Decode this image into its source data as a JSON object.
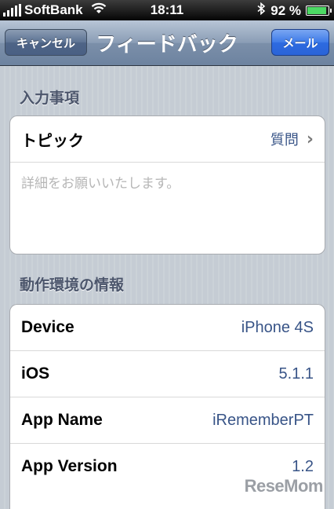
{
  "status_bar": {
    "carrier": "SoftBank",
    "time": "18:11",
    "battery_percent": "92 %",
    "battery_level": 0.92
  },
  "nav": {
    "cancel_label": "キャンセル",
    "title": "フィードバック",
    "mail_label": "メール"
  },
  "input_section": {
    "header": "入力事項",
    "topic_label": "トピック",
    "topic_value": "質問",
    "details_placeholder": "詳細をお願いいたします。"
  },
  "env_section": {
    "header": "動作環境の情報",
    "rows": [
      {
        "label": "Device",
        "value": "iPhone 4S"
      },
      {
        "label": "iOS",
        "value": "5.1.1"
      },
      {
        "label": "App Name",
        "value": "iRememberPT"
      },
      {
        "label": "App Version",
        "value": "1.2"
      }
    ]
  },
  "watermark": "ReseMom"
}
